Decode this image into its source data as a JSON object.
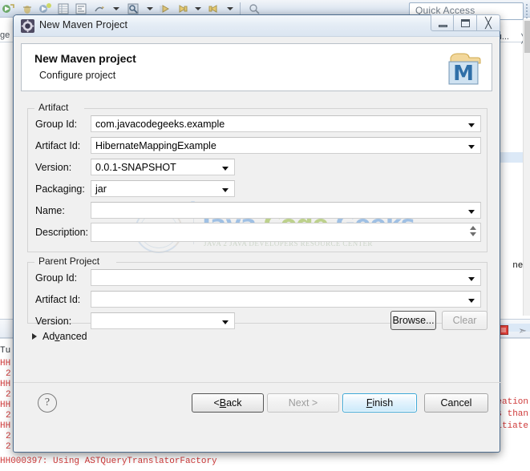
{
  "ide": {
    "quick_access_placeholder": "Quick Access",
    "left_tab_label": "ge",
    "right_tab_label": "u...",
    "right_tab_close_icon": "close-icon",
    "code_fragment": "ne)",
    "console_lines": [
      "eation",
      "s than",
      "nitiate"
    ],
    "console_gutter": [
      "HH",
      "2",
      "HH",
      "2",
      "HH",
      "2",
      "HH",
      "2"
    ],
    "console_tu_label": "Tu",
    "console_bottom_line": "HH000397: Using ASTQueryTranslatorFactory",
    "toolbar_icons": [
      "run-icon",
      "debug-icon",
      "coverage-icon",
      "table-icon",
      "format-icon",
      "external-tools-icon",
      "search-icon",
      "back-icon",
      "forward-icon",
      "next-annotation-icon",
      "open-type-icon"
    ]
  },
  "dialog": {
    "title": "New Maven Project",
    "title_icon": "maven-gear-icon",
    "window_buttons": {
      "minimize": "minimize-icon",
      "maximize": "maximize-icon",
      "close": "close-icon"
    },
    "header": {
      "title": "New Maven project",
      "subtitle": "Configure project",
      "logo": "maven-m-logo"
    },
    "watermark": {
      "mark": "JCG",
      "main_first": "Java",
      "main_second": "Code",
      "main_third": "Geeks",
      "subtitle": "JAVA 2 JAVA DEVELOPERS RESOURCE CENTER"
    },
    "artifact": {
      "legend": "Artifact",
      "fields": [
        {
          "label": "Group Id:",
          "value": "com.javacodegeeks.example",
          "type": "combo-wide"
        },
        {
          "label": "Artifact Id:",
          "value": "HibernateMappingExample",
          "type": "combo-wide"
        },
        {
          "label": "Version:",
          "value": "0.0.1-SNAPSHOT",
          "type": "combo-short"
        },
        {
          "label": "Packaging:",
          "value": "jar",
          "type": "combo-short"
        },
        {
          "label": "Name:",
          "value": "",
          "type": "combo-wide"
        },
        {
          "label": "Description:",
          "value": "",
          "type": "textarea"
        }
      ]
    },
    "parent": {
      "legend": "Parent Project",
      "fields": [
        {
          "label": "Group Id:",
          "value": "",
          "type": "combo-wide"
        },
        {
          "label": "Artifact Id:",
          "value": "",
          "type": "combo-wide"
        },
        {
          "label": "Version:",
          "value": "",
          "type": "combo-short"
        }
      ],
      "browse_label": "Browse...",
      "clear_label": "Clear"
    },
    "advanced_label": "Advanced",
    "buttons": {
      "help": "?",
      "back": "< Back",
      "next": "Next >",
      "finish": "Finish",
      "cancel": "Cancel"
    }
  },
  "colors": {
    "dialog_bg": "#f0f0f0",
    "accent_blue": "#3fa9d8",
    "console_red": "#cf3a3a",
    "watermark_blue": "#6fa3dd",
    "watermark_green": "#9fbf4f"
  }
}
